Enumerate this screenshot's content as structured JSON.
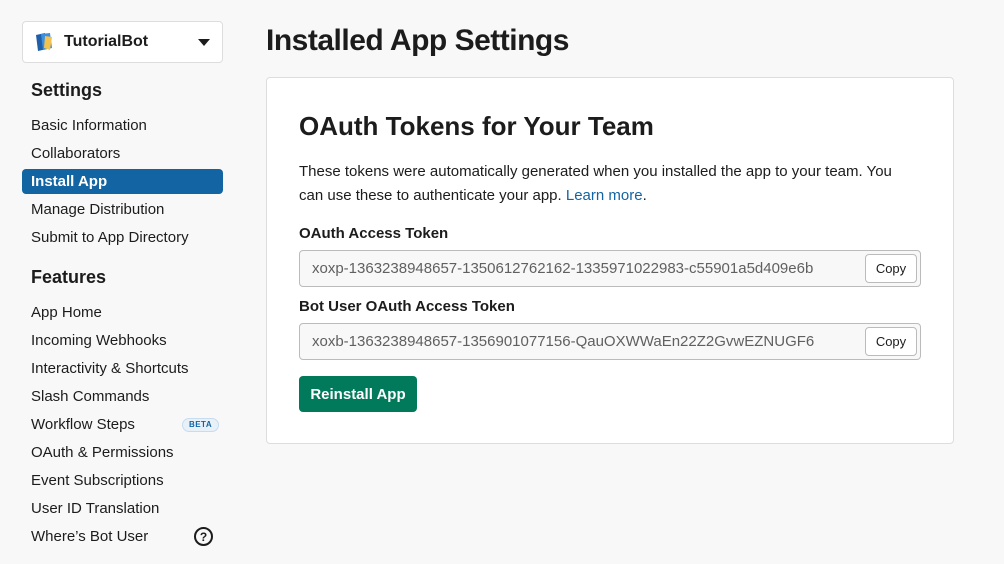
{
  "app_selector": {
    "name": "TutorialBot",
    "icon": "app-icon"
  },
  "sidebar": {
    "settings_title": "Settings",
    "settings_items": [
      {
        "label": "Basic Information"
      },
      {
        "label": "Collaborators"
      },
      {
        "label": "Install App",
        "active": true
      },
      {
        "label": "Manage Distribution"
      },
      {
        "label": "Submit to App Directory"
      }
    ],
    "features_title": "Features",
    "features_items": [
      {
        "label": "App Home"
      },
      {
        "label": "Incoming Webhooks"
      },
      {
        "label": "Interactivity & Shortcuts"
      },
      {
        "label": "Slash Commands"
      },
      {
        "label": "Workflow Steps",
        "badge": "BETA"
      },
      {
        "label": "OAuth & Permissions"
      },
      {
        "label": "Event Subscriptions"
      },
      {
        "label": "User ID Translation"
      },
      {
        "label": "Where’s Bot User",
        "icon": "help-icon"
      }
    ],
    "help_glyph": "?"
  },
  "main": {
    "page_title": "Installed App Settings",
    "card": {
      "title": "OAuth Tokens for Your Team",
      "description": "These tokens were automatically generated when you installed the app to your team. You can use these to authenticate your app.",
      "learn_more": "Learn more",
      "desc_end": ".",
      "access_token_label": "OAuth Access Token",
      "access_token_value": "xoxp-1363238948657-1350612762162-1335971022983-c55901a5d409e6b",
      "bot_token_label": "Bot User OAuth Access Token",
      "bot_token_value": "xoxb-1363238948657-1356901077156-QauOXWWaEn22Z2GvwEZNUGF6",
      "copy_label": "Copy",
      "reinstall_label": "Reinstall App"
    }
  },
  "colors": {
    "active_nav": "#1264a3",
    "link": "#1264a3",
    "primary_button": "#007a5a",
    "background": "#f8f8f8"
  }
}
